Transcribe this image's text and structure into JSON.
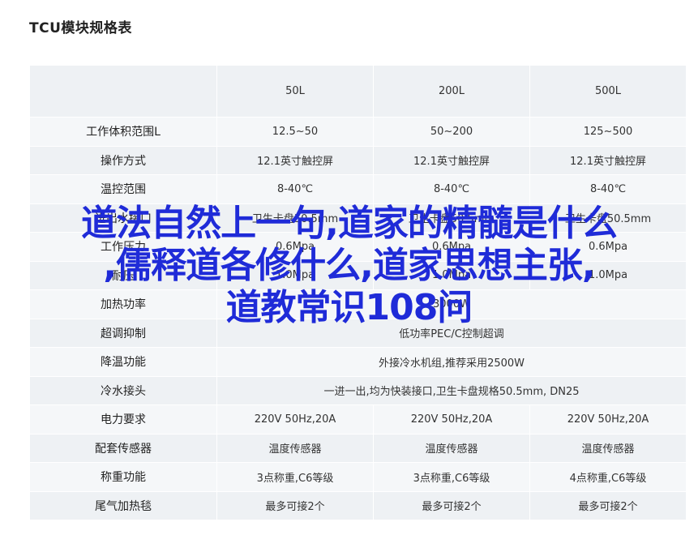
{
  "title": "TCU模块规格表",
  "table": {
    "models": [
      "50L",
      "200L",
      "500L"
    ],
    "rows": [
      {
        "label": "工作体积范围L",
        "values": [
          "12.5~50",
          "50~200",
          "125~500"
        ]
      },
      {
        "label": "操作方式",
        "values": [
          "12.1英寸触控屏",
          "12.1英寸触控屏",
          "12.1英寸触控屏"
        ]
      },
      {
        "label": "温控范围",
        "values": [
          "8-40℃",
          "8-40℃",
          "8-40℃"
        ]
      },
      {
        "label": "进出水接口",
        "values": [
          "卫生卡盘50.5mm",
          "卫生卡盘50.5mm",
          "卫生卡盘50.5mm"
        ]
      },
      {
        "label": "工作压力",
        "values": [
          "0.6Mpa",
          "0.6Mpa",
          "0.6Mpa"
        ]
      },
      {
        "label": "耐压",
        "values": [
          "1.0Mpa",
          "1.0Mpa",
          "1.0Mpa"
        ]
      },
      {
        "label": "加热功率",
        "span": "3000W"
      },
      {
        "label": "超调抑制",
        "span": "低功率PEC/C控制超调"
      },
      {
        "label": "降温功能",
        "span": "外接冷水机组,推荐采用2500W"
      },
      {
        "label": "冷水接头",
        "span": "一进一出,均为快装接口,卫生卡盘规格50.5mm, DN25"
      },
      {
        "label": "电力要求",
        "values": [
          "220V 50Hz,20A",
          "220V 50Hz,20A",
          "220V 50Hz,20A"
        ]
      },
      {
        "label": "配套传感器",
        "values": [
          "温度传感器",
          "温度传感器",
          "温度传感器"
        ]
      },
      {
        "label": "称重功能",
        "values": [
          "3点称重,C6等级",
          "3点称重,C6等级",
          "4点称重,C6等级"
        ]
      },
      {
        "label": "尾气加热毯",
        "values": [
          "最多可接2个",
          "最多可接2个",
          "最多可接2个"
        ]
      }
    ]
  },
  "overlay": {
    "line1": "道法自然上一句,道家的精髓是什么",
    "line2": ",儒释道各修什么,道家思想主张,",
    "line3": "道教常识108问"
  }
}
